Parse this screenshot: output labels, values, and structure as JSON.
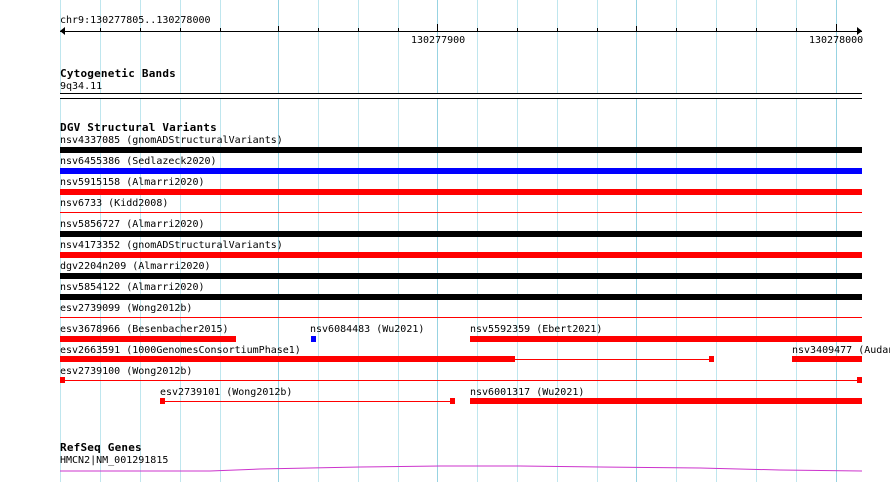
{
  "ruler": {
    "location": "chr9:130277805..130278000",
    "tick_labels": [
      "130277900",
      "130278000"
    ]
  },
  "tracks": {
    "cytoband": {
      "title": "Cytogenetic Bands",
      "band": "9q34.11"
    },
    "dgv": {
      "title": "DGV Structural Variants",
      "features": [
        {
          "label": "nsv4337085 (gnomADStructuralVariants)",
          "color": "#000000",
          "style": "thick"
        },
        {
          "label": "nsv6455386 (Sedlazeck2020)",
          "color": "#0000ff",
          "style": "thick"
        },
        {
          "label": "nsv5915158 (Almarri2020)",
          "color": "#ff0000",
          "style": "thick"
        },
        {
          "label": "nsv6733 (Kidd2008)",
          "color": "#ff0000",
          "style": "thin"
        },
        {
          "label": "nsv5856727 (Almarri2020)",
          "color": "#000000",
          "style": "thick"
        },
        {
          "label": "nsv4173352 (gnomADStructuralVariants)",
          "color": "#ff0000",
          "style": "thick"
        },
        {
          "label": "dgv2204n209 (Almarri2020)",
          "color": "#000000",
          "style": "thick"
        },
        {
          "label": "nsv5854122 (Almarri2020)",
          "color": "#000000",
          "style": "thick"
        },
        {
          "label": "esv2739099 (Wong2012b)",
          "color": "#ff0000",
          "style": "thin"
        },
        {
          "label": "esv3678966 (Besenbacher2015)",
          "color": "#ff0000",
          "style": "thick"
        },
        {
          "label": "nsv6084483 (Wu2021)",
          "color": "#0000ff",
          "style": "thick"
        },
        {
          "label": "nsv5592359 (Ebert2021)",
          "color": "#ff0000",
          "style": "thick"
        },
        {
          "label": "esv2663591 (1000GenomesConsortiumPhase1)",
          "color": "#ff0000",
          "style": "split"
        },
        {
          "label": "nsv3409477 (Audan",
          "color": "#ff0000",
          "style": "thick"
        },
        {
          "label": "esv2739100 (Wong2012b)",
          "color": "#ff0000",
          "style": "split"
        },
        {
          "label": "esv2739101 (Wong2012b)",
          "color": "#ff0000",
          "style": "split"
        },
        {
          "label": "nsv6001317 (Wu2021)",
          "color": "#ff0000",
          "style": "thick"
        }
      ]
    },
    "refseq": {
      "title": "RefSeq Genes",
      "gene_label": "HMCN2|NM_001291815",
      "color": "#cc33cc"
    }
  }
}
